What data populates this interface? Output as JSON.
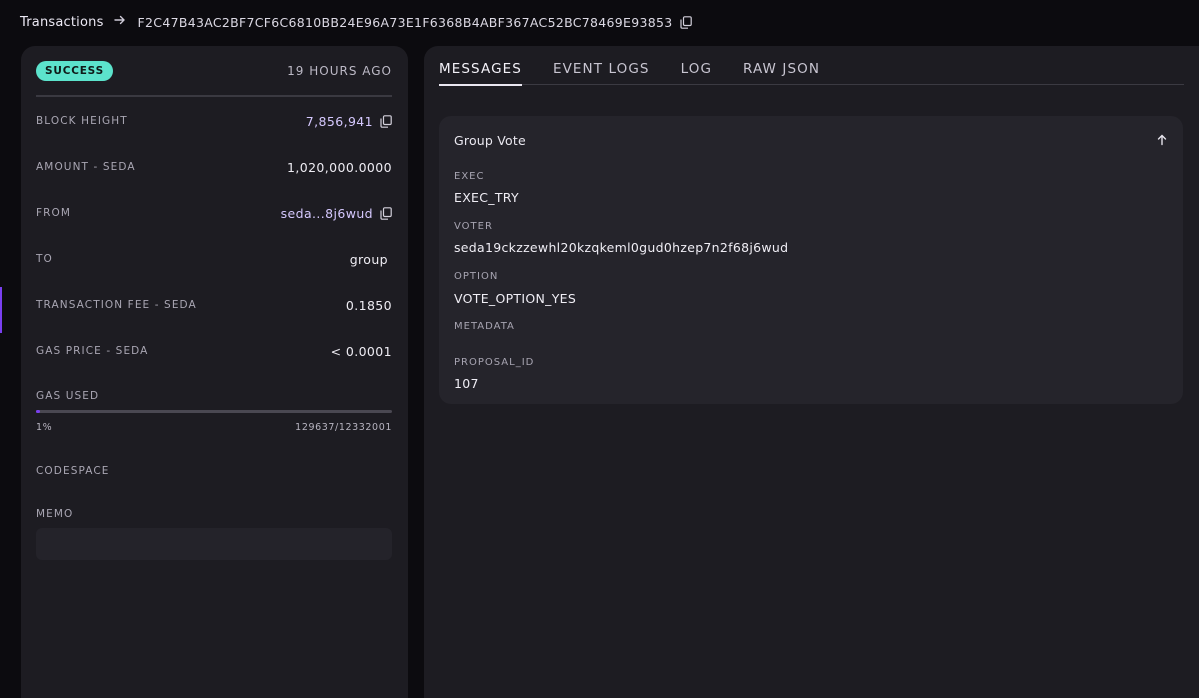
{
  "breadcrumb": {
    "parent": "Transactions",
    "hash": "F2C47B43AC2BF7CF6C6810BB24E96A73E1F6368B4ABF367AC52BC78469E93853"
  },
  "summary": {
    "status": "SUCCESS",
    "time_ago": "19 HOURS AGO",
    "fields": {
      "block_height": {
        "label": "BLOCK HEIGHT",
        "value": "7,856,941"
      },
      "amount": {
        "label": "AMOUNT - SEDA",
        "value": "1,020,000.0000"
      },
      "from": {
        "label": "FROM",
        "value": "seda...8j6wud"
      },
      "to": {
        "label": "TO",
        "value": "group"
      },
      "fee": {
        "label": "TRANSACTION FEE - SEDA",
        "value": "0.1850"
      },
      "gas_price": {
        "label": "GAS PRICE - SEDA",
        "value": "< 0.0001"
      }
    },
    "gas_used": {
      "label": "GAS USED",
      "percent_text": "1%",
      "ratio_text": "129637/12332001",
      "fraction": 0.0105
    },
    "codespace": {
      "label": "CODESPACE"
    },
    "memo": {
      "label": "MEMO"
    }
  },
  "tabs": [
    {
      "label": "MESSAGES"
    },
    {
      "label": "EVENT LOGS"
    },
    {
      "label": "LOG"
    },
    {
      "label": "RAW JSON"
    }
  ],
  "message": {
    "title": "Group Vote",
    "exec": {
      "label": "EXEC",
      "value": "EXEC_TRY"
    },
    "voter": {
      "label": "VOTER",
      "value": "seda19ckzzewhl20kzqkeml0gud0hzep7n2f68j6wud"
    },
    "option": {
      "label": "OPTION",
      "value": "VOTE_OPTION_YES"
    },
    "metadata": {
      "label": "METADATA"
    },
    "proposal_id": {
      "label": "PROPOSAL_ID",
      "value": "107"
    }
  },
  "icons": {
    "copy": "copy-icon",
    "arrow": "arrow-right-icon",
    "collapse": "arrow-up-icon"
  },
  "colors": {
    "accent": "#7a3ff0",
    "success": "#5ce3cc",
    "address": "#d6c9ff"
  }
}
